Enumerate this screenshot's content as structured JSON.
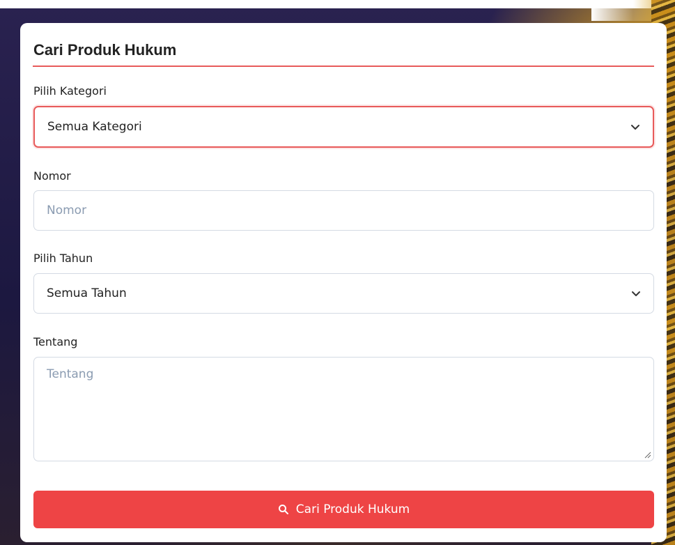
{
  "form": {
    "title": "Cari Produk Hukum",
    "kategori": {
      "label": "Pilih Kategori",
      "selected": "Semua Kategori"
    },
    "nomor": {
      "label": "Nomor",
      "placeholder": "Nomor",
      "value": ""
    },
    "tahun": {
      "label": "Pilih Tahun",
      "selected": "Semua Tahun"
    },
    "tentang": {
      "label": "Tentang",
      "placeholder": "Tentang",
      "value": ""
    },
    "submit_label": "Cari Produk Hukum",
    "submit_icon": "search-icon"
  },
  "colors": {
    "accent": "#ee4445",
    "focus_border": "#e85a5a",
    "placeholder": "#8a9bb1",
    "border": "#d4dae3"
  }
}
